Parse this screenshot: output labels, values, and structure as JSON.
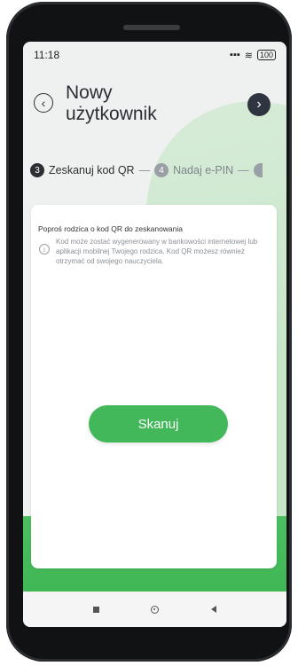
{
  "status_bar": {
    "time": "11:18",
    "signal": "▪▪▪",
    "wifi": "≋",
    "battery": "100"
  },
  "header": {
    "back_symbol": "‹",
    "title_line1": "Nowy",
    "title_line2": "użytkownik",
    "next_symbol": "›"
  },
  "steps": [
    {
      "number": "3",
      "label": "Zeskanuj kod QR",
      "state": "active"
    },
    {
      "number": "4",
      "label": "Nadaj e-PIN",
      "state": "inactive"
    }
  ],
  "steps_separator": "—",
  "card": {
    "title": "Poproś rodzica o kod QR do zeskanowania",
    "info_symbol": "i",
    "info_text": "Kod może zostać wygenerowany w bankowości internetowej lub aplikacji mobilnej Twojego rodzica. Kod QR możesz również otrzymać od swojego nauczyciela.",
    "scan_button": "Skanuj"
  },
  "colors": {
    "accent_green": "#43b85a",
    "dark": "#2c2f33"
  },
  "icons": [
    "back-icon",
    "next-icon",
    "info-icon",
    "nav-recents-icon",
    "nav-home-icon",
    "nav-back-icon"
  ]
}
